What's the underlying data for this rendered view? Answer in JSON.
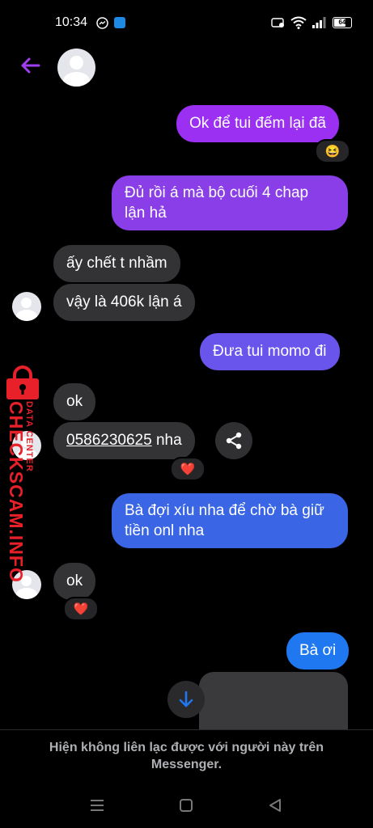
{
  "status_bar": {
    "time": "10:34",
    "battery": "64"
  },
  "messages": [
    {
      "dir": "out",
      "text": "Ok để tui đếm lại đã",
      "reaction": "😆"
    },
    {
      "dir": "out",
      "line1": "Đủ rồi á mà bộ cuối 4 chap",
      "line2": "lận hả"
    },
    {
      "dir": "in",
      "text": "ấy chết t nhầm"
    },
    {
      "dir": "in",
      "text": "vậy là 406k lận á"
    },
    {
      "dir": "out",
      "text": "Đưa tui momo đi"
    },
    {
      "dir": "in",
      "text": "ok"
    },
    {
      "dir": "in",
      "phone": "0586230625",
      "suffix": " nha",
      "reaction": "❤️"
    },
    {
      "dir": "out",
      "line1": "Bà đợi xíu nha để chờ bà giữ",
      "line2": "tiền onl nha"
    },
    {
      "dir": "in",
      "text": "ok",
      "reaction": "❤️"
    },
    {
      "dir": "out",
      "text": "Bà ơi"
    }
  ],
  "watermark": {
    "brand": "CHECKSCAM.INFO",
    "sub": "DATA CENTER"
  },
  "footer": {
    "notice": "Hiện không liên lạc được với người này trên Messenger."
  },
  "colors": {
    "accent": "#9b2ff2",
    "bubble_in": "#333336",
    "watermark": "#e8202a"
  },
  "icons": [
    "back-arrow-icon",
    "share-icon",
    "scroll-down-icon",
    "messenger-icon",
    "app-icon",
    "wifi-icon",
    "signal-icon",
    "battery-icon"
  ]
}
